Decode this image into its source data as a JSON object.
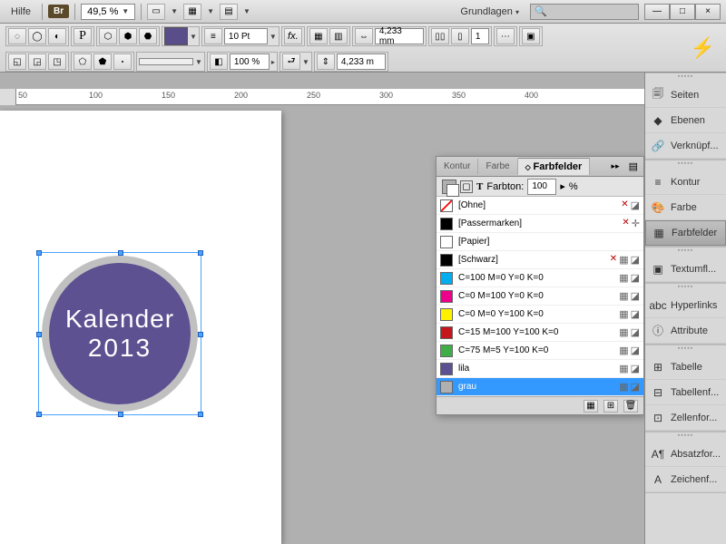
{
  "menu": {
    "help": "Hilfe",
    "br": "Br",
    "zoom": "49,5 %",
    "essentials": "Grundlagen"
  },
  "toolbar": {
    "stroke_size": "10 Pt",
    "opacity": "100 %",
    "w": "4,233 mm",
    "h": "4,233 m",
    "cols": "1"
  },
  "ruler": {
    "t50": "50",
    "t100": "100",
    "t150": "150",
    "t200": "200",
    "t250": "250",
    "t300": "300",
    "t350": "350",
    "t400": "400"
  },
  "artwork": {
    "line1": "Kalender",
    "line2": "2013"
  },
  "swatchPanel": {
    "tabs": {
      "kontur": "Kontur",
      "farbe": "Farbe",
      "farbfelder": "Farbfelder"
    },
    "tint_label": "Farbton:",
    "tint_val": "100",
    "tint_suffix": "%",
    "rows": [
      {
        "name": "[Ohne]",
        "chip": "none",
        "locked": true,
        "global": true
      },
      {
        "name": "[Passermarken]",
        "chip": "#000000",
        "locked": true,
        "reg": true
      },
      {
        "name": "[Papier]",
        "chip": "#ffffff"
      },
      {
        "name": "[Schwarz]",
        "chip": "#000000",
        "locked": true,
        "proc": true
      },
      {
        "name": "C=100 M=0 Y=0 K=0",
        "chip": "#00aeef",
        "proc": true
      },
      {
        "name": "C=0 M=100 Y=0 K=0",
        "chip": "#ec008c",
        "proc": true
      },
      {
        "name": "C=0 M=0 Y=100 K=0",
        "chip": "#fff200",
        "proc": true
      },
      {
        "name": "C=15 M=100 Y=100 K=0",
        "chip": "#c4161c",
        "proc": true
      },
      {
        "name": "C=75 M=5 Y=100 K=0",
        "chip": "#3fae49",
        "proc": true
      },
      {
        "name": "lila",
        "chip": "#5d5191",
        "proc": true
      },
      {
        "name": "grau",
        "chip": "#b0b0b0",
        "proc": true,
        "selected": true
      }
    ]
  },
  "side": {
    "seiten": "Seiten",
    "ebenen": "Ebenen",
    "verkn": "Verknüpf...",
    "kontur": "Kontur",
    "farbe": "Farbe",
    "farbfelder": "Farbfelder",
    "textumfl": "Textumfl...",
    "hyperlinks": "Hyperlinks",
    "attribute": "Attribute",
    "tabelle": "Tabelle",
    "tabellenf": "Tabellenf...",
    "zellenfor": "Zellenfor...",
    "absatzfor": "Absatzfor...",
    "zeichenf": "Zeichenf..."
  }
}
